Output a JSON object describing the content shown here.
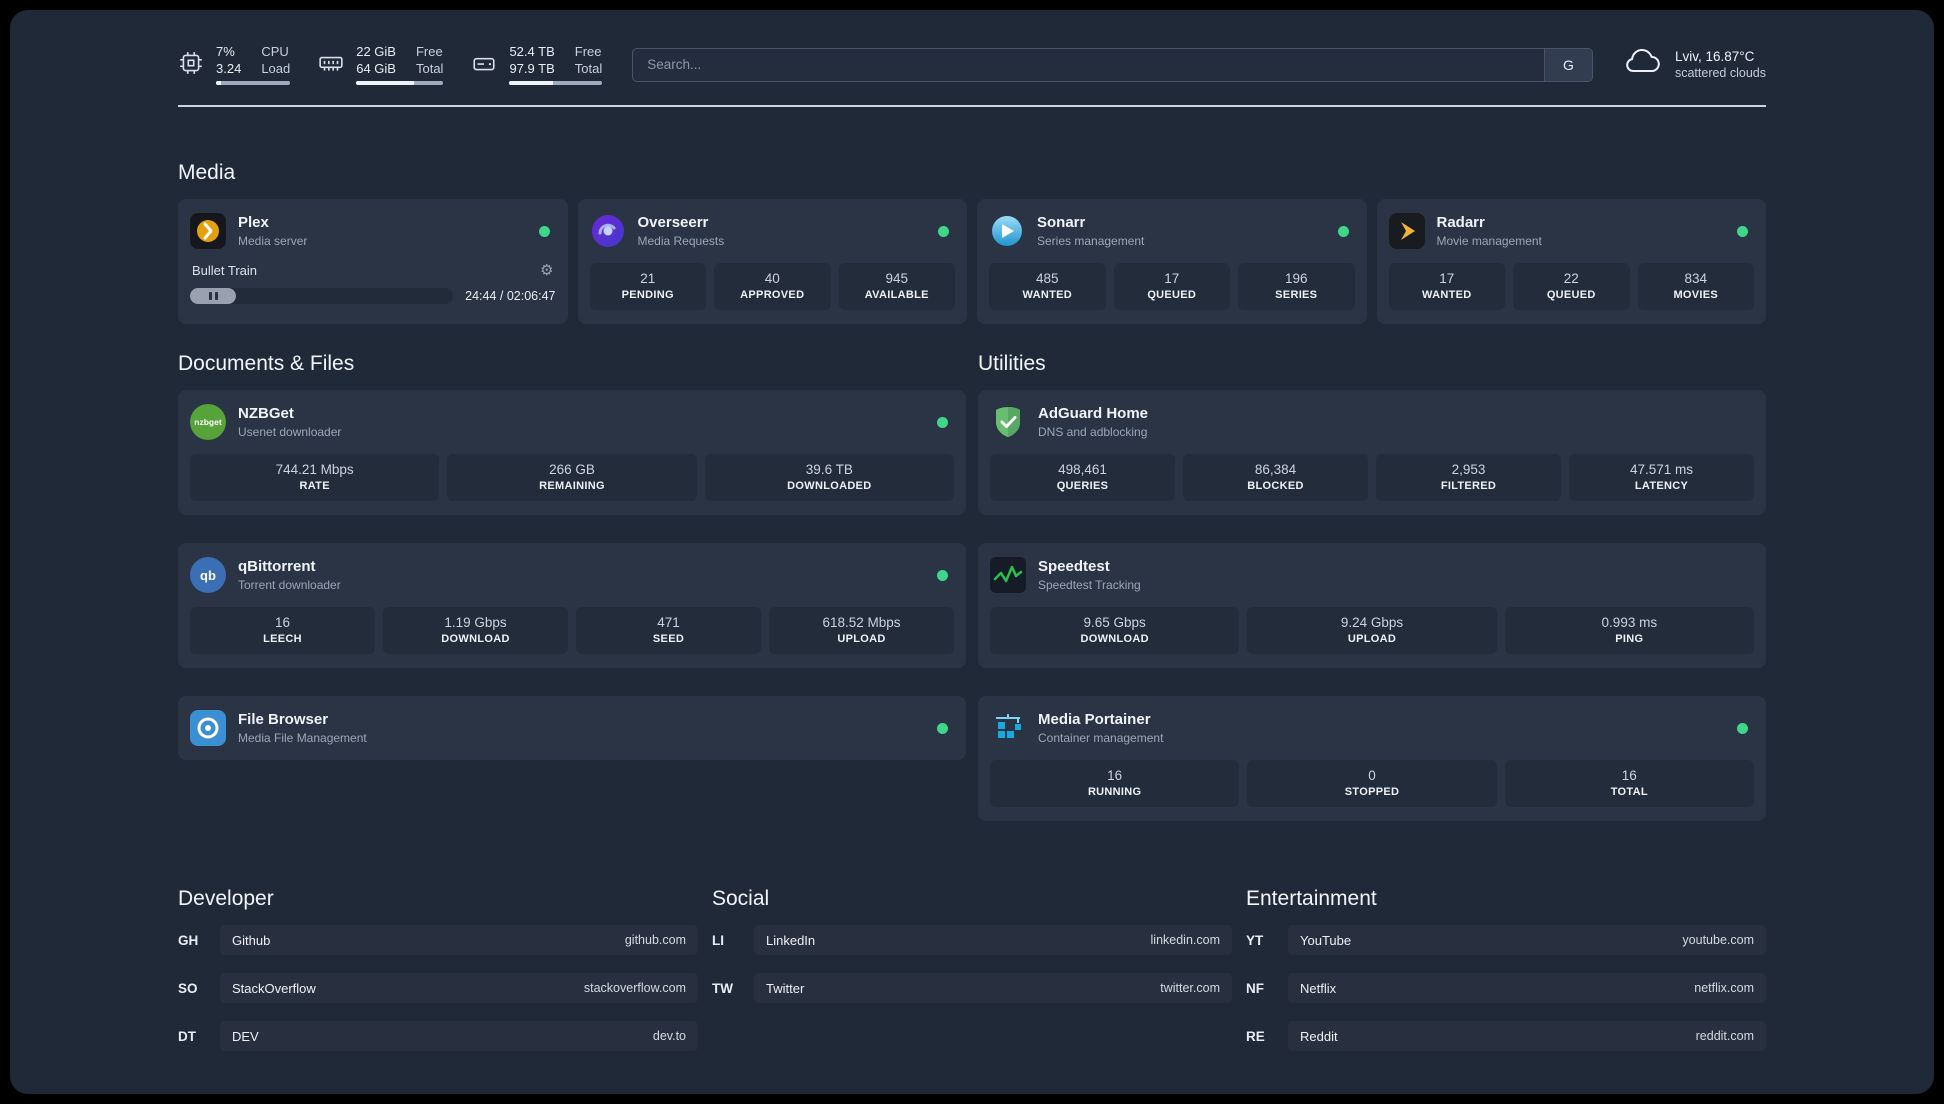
{
  "colors": {
    "background": "#202938",
    "card": "#2a3444",
    "tile": "#232c3b",
    "status_online": "#3fd68c",
    "divider": "#cdd4e0"
  },
  "topbar": {
    "cpu": {
      "value1": "7%",
      "label1": "CPU",
      "value2": "3.24",
      "label2": "Load",
      "progress_pct": 7
    },
    "memory": {
      "value1": "22 GiB",
      "label1": "Free",
      "value2": "64 GiB",
      "label2": "Total",
      "progress_pct": 66
    },
    "disk": {
      "value1": "52.4 TB",
      "label1": "Free",
      "value2": "97.9 TB",
      "label2": "Total",
      "progress_pct": 47
    },
    "search": {
      "placeholder": "Search...",
      "button_label": "G"
    },
    "weather": {
      "location": "Lviv, 16.87°C",
      "condition": "scattered clouds"
    }
  },
  "media": {
    "title": "Media",
    "cards": [
      {
        "name": "Plex",
        "subtitle": "Media server",
        "status": "online",
        "player": {
          "track": "Bullet Train",
          "time": "24:44 / 02:06:47"
        }
      },
      {
        "name": "Overseerr",
        "subtitle": "Media Requests",
        "status": "online",
        "stats": [
          {
            "value": "21",
            "label": "PENDING"
          },
          {
            "value": "40",
            "label": "APPROVED"
          },
          {
            "value": "945",
            "label": "AVAILABLE"
          }
        ]
      },
      {
        "name": "Sonarr",
        "subtitle": "Series management",
        "status": "online",
        "stats": [
          {
            "value": "485",
            "label": "WANTED"
          },
          {
            "value": "17",
            "label": "QUEUED"
          },
          {
            "value": "196",
            "label": "SERIES"
          }
        ]
      },
      {
        "name": "Radarr",
        "subtitle": "Movie management",
        "status": "online",
        "stats": [
          {
            "value": "17",
            "label": "WANTED"
          },
          {
            "value": "22",
            "label": "QUEUED"
          },
          {
            "value": "834",
            "label": "MOVIES"
          }
        ]
      }
    ]
  },
  "documents": {
    "title": "Documents & Files",
    "cards": [
      {
        "name": "NZBGet",
        "subtitle": "Usenet downloader",
        "status": "online",
        "icon_label": "nzbget",
        "stats": [
          {
            "value": "744.21 Mbps",
            "label": "RATE"
          },
          {
            "value": "266 GB",
            "label": "REMAINING"
          },
          {
            "value": "39.6 TB",
            "label": "DOWNLOADED"
          }
        ]
      },
      {
        "name": "qBittorrent",
        "subtitle": "Torrent downloader",
        "status": "online",
        "icon_label": "qb",
        "stats": [
          {
            "value": "16",
            "label": "LEECH"
          },
          {
            "value": "1.19 Gbps",
            "label": "DOWNLOAD"
          },
          {
            "value": "471",
            "label": "SEED"
          },
          {
            "value": "618.52 Mbps",
            "label": "UPLOAD"
          }
        ]
      },
      {
        "name": "File Browser",
        "subtitle": "Media File Management",
        "status": "online"
      }
    ]
  },
  "utilities": {
    "title": "Utilities",
    "cards": [
      {
        "name": "AdGuard Home",
        "subtitle": "DNS and adblocking",
        "status": "online",
        "stats": [
          {
            "value": "498,461",
            "label": "QUERIES"
          },
          {
            "value": "86,384",
            "label": "BLOCKED"
          },
          {
            "value": "2,953",
            "label": "FILTERED"
          },
          {
            "value": "47.571 ms",
            "label": "LATENCY"
          }
        ]
      },
      {
        "name": "Speedtest",
        "subtitle": "Speedtest Tracking",
        "status": "online",
        "stats": [
          {
            "value": "9.65 Gbps",
            "label": "DOWNLOAD"
          },
          {
            "value": "9.24 Gbps",
            "label": "UPLOAD"
          },
          {
            "value": "0.993 ms",
            "label": "PING"
          }
        ]
      },
      {
        "name": "Media Portainer",
        "subtitle": "Container management",
        "status": "online",
        "stats": [
          {
            "value": "16",
            "label": "RUNNING"
          },
          {
            "value": "0",
            "label": "STOPPED"
          },
          {
            "value": "16",
            "label": "TOTAL"
          }
        ]
      }
    ]
  },
  "links": {
    "developer": {
      "title": "Developer",
      "items": [
        {
          "abbr": "GH",
          "name": "Github",
          "url": "github.com"
        },
        {
          "abbr": "SO",
          "name": "StackOverflow",
          "url": "stackoverflow.com"
        },
        {
          "abbr": "DT",
          "name": "DEV",
          "url": "dev.to"
        }
      ]
    },
    "social": {
      "title": "Social",
      "items": [
        {
          "abbr": "LI",
          "name": "LinkedIn",
          "url": "linkedin.com"
        },
        {
          "abbr": "TW",
          "name": "Twitter",
          "url": "twitter.com"
        }
      ]
    },
    "entertainment": {
      "title": "Entertainment",
      "items": [
        {
          "abbr": "YT",
          "name": "YouTube",
          "url": "youtube.com"
        },
        {
          "abbr": "NF",
          "name": "Netflix",
          "url": "netflix.com"
        },
        {
          "abbr": "RE",
          "name": "Reddit",
          "url": "reddit.com"
        }
      ]
    }
  }
}
